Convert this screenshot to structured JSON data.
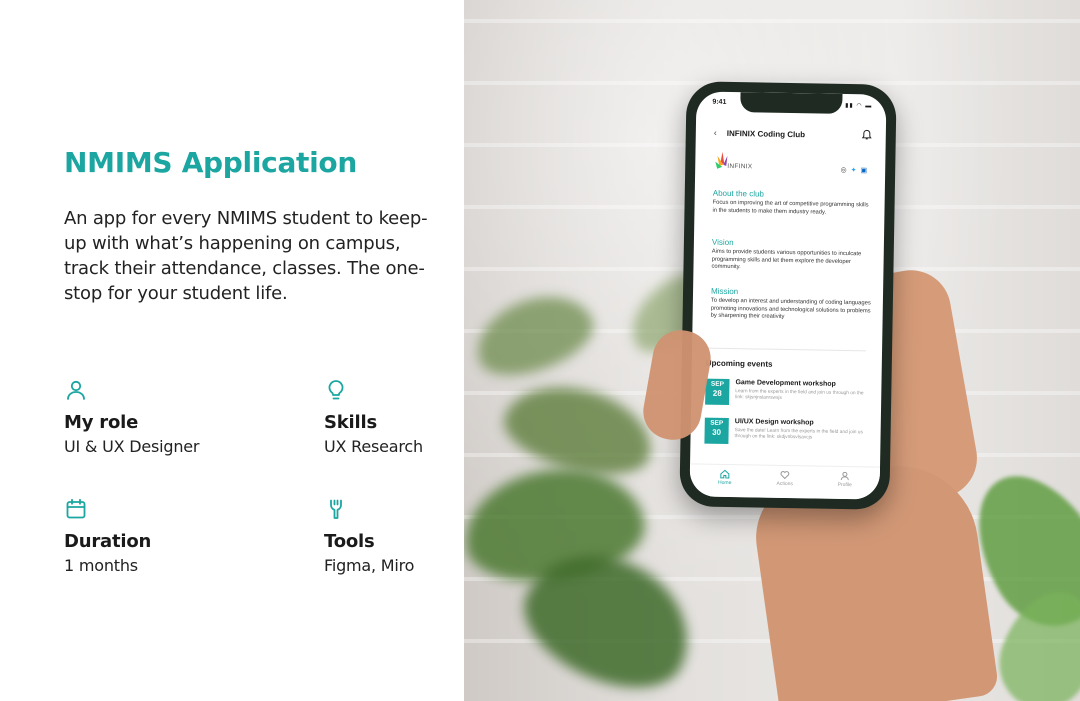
{
  "accent_color": "#1ba6a1",
  "project": {
    "title": "NMIMS Application",
    "description": "An app for every NMIMS student to keep-up with what’s happening on campus, track their attendance, classes. The one-stop for your student life."
  },
  "meta": {
    "role": {
      "icon": "user-icon",
      "label": "My role",
      "value": "UI & UX Designer"
    },
    "skills": {
      "icon": "lightbulb-icon",
      "label": "Skills",
      "value": "UX Research"
    },
    "duration": {
      "icon": "calendar-icon",
      "label": "Duration",
      "value": "1 months"
    },
    "tools": {
      "icon": "wrench-icon",
      "label": "Tools",
      "value": "Figma, Miro"
    }
  },
  "phone": {
    "status_time": "9:41",
    "header_title": "INFINIX Coding Club",
    "logo_text": "INFINIX",
    "sections": [
      {
        "heading": "About the club",
        "body": "Focus on improving the art of competitive programming skills in the students to make them industry ready."
      },
      {
        "heading": "Vision",
        "body": "Aims to provide students various opportunities to inculcate programming skills and let them explore the developer community."
      },
      {
        "heading": "Mission",
        "body": "To develop an interest and understanding of coding languages promoting innovations and technological solutions to problems by sharpening their creativity"
      }
    ],
    "upcoming_title": "Upcoming events",
    "events": [
      {
        "month": "SEP",
        "day": "28",
        "title": "Game Development workshop",
        "desc": "Learn from the experts in the field and join us through on the link: skjsnjnslanrswsjs"
      },
      {
        "month": "SEP",
        "day": "30",
        "title": "UI/UX Design workshop",
        "desc": "Save the date! Learn from the experts in the field and join us through on the link: skdjvnbsvlsavcjs"
      }
    ],
    "tabs": [
      {
        "icon": "home-icon",
        "label": "Home"
      },
      {
        "icon": "heart-icon",
        "label": "Actions"
      },
      {
        "icon": "profile-icon",
        "label": "Profile"
      }
    ]
  }
}
